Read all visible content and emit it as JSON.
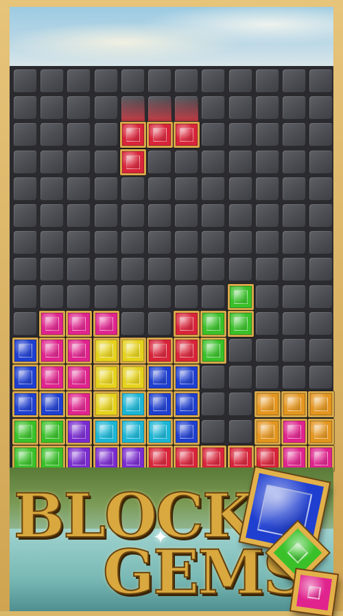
{
  "title": {
    "line1": "BLOCK",
    "line2": "GEMS"
  },
  "colors": {
    "frame": "#d9b86a",
    "gold_border": "#d6a74a",
    "board": "#2b2a2e",
    "cell": "#4a4c52",
    "gem": {
      "red": "#d9243a",
      "magenta": "#e0248e",
      "blue": "#1f3fd0",
      "green": "#3ac12a",
      "yellow": "#e6d21c",
      "cyan": "#1bb6d6",
      "purple": "#7a2bd0",
      "orange": "#e5961f"
    }
  },
  "board": {
    "cols": 12,
    "rows": 15,
    "falling_piece": {
      "color": "red",
      "cells": [
        [
          4,
          2
        ],
        [
          5,
          2
        ],
        [
          6,
          2
        ],
        [
          4,
          3
        ]
      ]
    },
    "gems": [
      {
        "c": 8,
        "r": 8,
        "color": "green"
      },
      {
        "c": 1,
        "r": 9,
        "color": "magenta"
      },
      {
        "c": 2,
        "r": 9,
        "color": "magenta"
      },
      {
        "c": 3,
        "r": 9,
        "color": "magenta"
      },
      {
        "c": 6,
        "r": 9,
        "color": "red"
      },
      {
        "c": 7,
        "r": 9,
        "color": "green"
      },
      {
        "c": 8,
        "r": 9,
        "color": "green"
      },
      {
        "c": 0,
        "r": 10,
        "color": "blue"
      },
      {
        "c": 1,
        "r": 10,
        "color": "magenta"
      },
      {
        "c": 2,
        "r": 10,
        "color": "magenta"
      },
      {
        "c": 3,
        "r": 10,
        "color": "yellow"
      },
      {
        "c": 4,
        "r": 10,
        "color": "yellow"
      },
      {
        "c": 5,
        "r": 10,
        "color": "red"
      },
      {
        "c": 6,
        "r": 10,
        "color": "red"
      },
      {
        "c": 7,
        "r": 10,
        "color": "green"
      },
      {
        "c": 0,
        "r": 11,
        "color": "blue"
      },
      {
        "c": 1,
        "r": 11,
        "color": "magenta"
      },
      {
        "c": 2,
        "r": 11,
        "color": "magenta"
      },
      {
        "c": 3,
        "r": 11,
        "color": "yellow"
      },
      {
        "c": 4,
        "r": 11,
        "color": "yellow"
      },
      {
        "c": 5,
        "r": 11,
        "color": "blue"
      },
      {
        "c": 6,
        "r": 11,
        "color": "blue"
      },
      {
        "c": 0,
        "r": 12,
        "color": "blue"
      },
      {
        "c": 1,
        "r": 12,
        "color": "blue"
      },
      {
        "c": 2,
        "r": 12,
        "color": "magenta"
      },
      {
        "c": 3,
        "r": 12,
        "color": "yellow"
      },
      {
        "c": 4,
        "r": 12,
        "color": "cyan"
      },
      {
        "c": 5,
        "r": 12,
        "color": "blue"
      },
      {
        "c": 6,
        "r": 12,
        "color": "blue"
      },
      {
        "c": 9,
        "r": 12,
        "color": "orange"
      },
      {
        "c": 10,
        "r": 12,
        "color": "orange"
      },
      {
        "c": 11,
        "r": 12,
        "color": "orange"
      },
      {
        "c": 0,
        "r": 13,
        "color": "green"
      },
      {
        "c": 1,
        "r": 13,
        "color": "green"
      },
      {
        "c": 2,
        "r": 13,
        "color": "purple"
      },
      {
        "c": 3,
        "r": 13,
        "color": "cyan"
      },
      {
        "c": 4,
        "r": 13,
        "color": "cyan"
      },
      {
        "c": 5,
        "r": 13,
        "color": "cyan"
      },
      {
        "c": 6,
        "r": 13,
        "color": "blue"
      },
      {
        "c": 9,
        "r": 13,
        "color": "orange"
      },
      {
        "c": 10,
        "r": 13,
        "color": "magenta"
      },
      {
        "c": 11,
        "r": 13,
        "color": "orange"
      },
      {
        "c": 0,
        "r": 14,
        "color": "green"
      },
      {
        "c": 1,
        "r": 14,
        "color": "green"
      },
      {
        "c": 2,
        "r": 14,
        "color": "purple"
      },
      {
        "c": 3,
        "r": 14,
        "color": "purple"
      },
      {
        "c": 4,
        "r": 14,
        "color": "purple"
      },
      {
        "c": 5,
        "r": 14,
        "color": "red"
      },
      {
        "c": 6,
        "r": 14,
        "color": "red"
      },
      {
        "c": 7,
        "r": 14,
        "color": "red"
      },
      {
        "c": 8,
        "r": 14,
        "color": "red"
      },
      {
        "c": 9,
        "r": 14,
        "color": "red"
      },
      {
        "c": 10,
        "r": 14,
        "color": "magenta"
      },
      {
        "c": 11,
        "r": 14,
        "color": "magenta"
      }
    ]
  },
  "decor_gems": [
    "blue",
    "green",
    "magenta"
  ]
}
